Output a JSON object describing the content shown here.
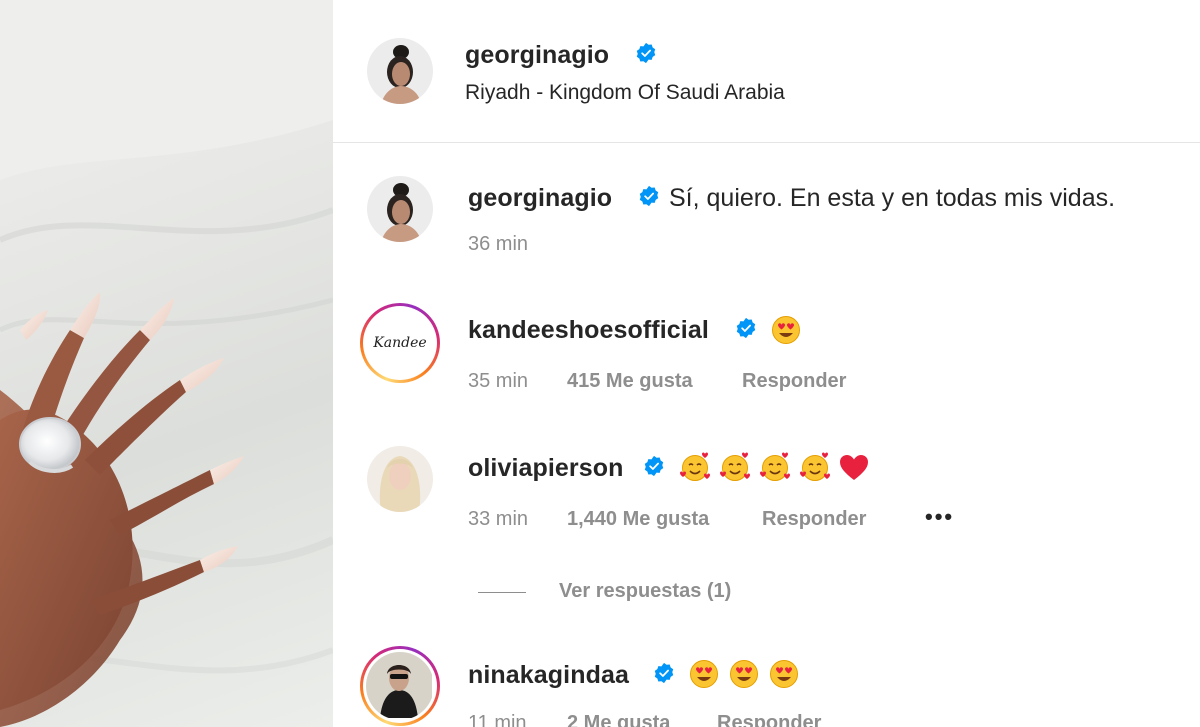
{
  "post": {
    "author": "georginagio",
    "location": "Riyadh - Kingdom Of Saudi Arabia"
  },
  "caption": {
    "author": "georginagio",
    "text": "Sí, quiero. En esta y en todas mis vidas.",
    "time": "36 min"
  },
  "comments": [
    {
      "author": "kandeeshoesofficial",
      "avatar_text": "Kandee",
      "emoji": [
        "smiling-face-with-heart-eyes"
      ],
      "time": "35 min",
      "likes": "415 Me gusta",
      "reply": "Responder"
    },
    {
      "author": "oliviapierson",
      "emoji": [
        "smiling-face-with-hearts",
        "smiling-face-with-hearts",
        "smiling-face-with-hearts",
        "smiling-face-with-hearts",
        "red-heart"
      ],
      "time": "33 min",
      "likes": "1,440 Me gusta",
      "reply": "Responder",
      "more": "•••",
      "view_replies": "Ver respuestas (1)"
    },
    {
      "author": "ninakagindaa",
      "emoji": [
        "smiling-face-with-heart-eyes",
        "smiling-face-with-heart-eyes",
        "smiling-face-with-heart-eyes"
      ],
      "time": "11 min",
      "likes": "2 Me gusta",
      "reply": "Responder"
    }
  ],
  "colors": {
    "verified": "#0095f6",
    "text": "#262626",
    "secondary": "#8e8e8e",
    "divider": "#e5e5e5"
  }
}
